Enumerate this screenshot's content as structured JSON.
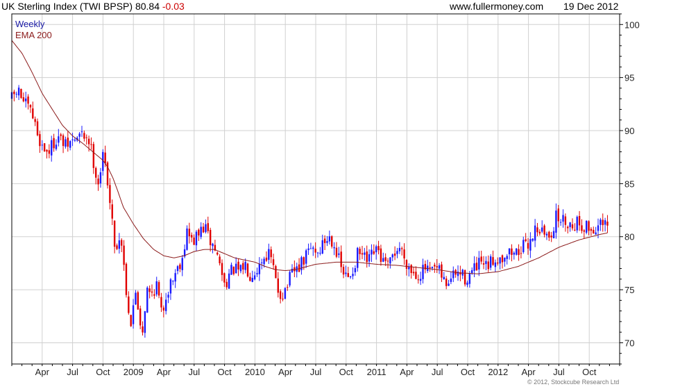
{
  "header": {
    "title": "UK Sterling Index (TWI BPSP)",
    "last": "80.84",
    "change": "-0.03",
    "site": "www.fullermoney.com",
    "date": "19 Dec 2012"
  },
  "legend": {
    "weekly": "Weekly",
    "ema": "EMA 200"
  },
  "copyright": "© 2012, Stockcube Research Ltd",
  "colors": {
    "up": "#1a1aff",
    "down": "#e00000",
    "ema": "#8b1a1a",
    "grid": "#d0d0d0",
    "frame": "#000000"
  },
  "chart_data": {
    "type": "candlestick",
    "title": "UK Sterling Index (TWI BPSP)",
    "ylim": [
      68,
      101
    ],
    "yticks": [
      70,
      75,
      80,
      85,
      90,
      95,
      100
    ],
    "x_axis_labels": [
      "Apr",
      "Jul",
      "Oct",
      "2009",
      "Apr",
      "Jul",
      "Oct",
      "2010",
      "Apr",
      "Jul",
      "Oct",
      "2011",
      "Apr",
      "Jul",
      "Oct",
      "2012",
      "Apr",
      "Jul",
      "Oct"
    ],
    "x_labels_month_index": [
      3,
      6,
      9,
      12,
      15,
      18,
      21,
      24,
      27,
      30,
      33,
      36,
      39,
      42,
      45,
      48,
      51,
      54,
      57
    ],
    "x_range_months": [
      0,
      60
    ],
    "weekly_close_anchors": [
      [
        0.0,
        93.0
      ],
      [
        0.6,
        93.8
      ],
      [
        1.3,
        92.5
      ],
      [
        2.0,
        91.5
      ],
      [
        2.6,
        89.5
      ],
      [
        3.0,
        88.5
      ],
      [
        3.6,
        88.0
      ],
      [
        4.5,
        89.5
      ],
      [
        5.3,
        88.5
      ],
      [
        6.0,
        89.0
      ],
      [
        6.7,
        89.5
      ],
      [
        7.5,
        89.5
      ],
      [
        8.0,
        87.5
      ],
      [
        8.5,
        85.0
      ],
      [
        9.0,
        87.5
      ],
      [
        9.4,
        86.0
      ],
      [
        9.8,
        82.0
      ],
      [
        10.3,
        78.5
      ],
      [
        10.7,
        80.5
      ],
      [
        11.0,
        78.0
      ],
      [
        11.4,
        74.0
      ],
      [
        11.8,
        71.5
      ],
      [
        12.2,
        75.0
      ],
      [
        12.6,
        72.5
      ],
      [
        12.9,
        71.0
      ],
      [
        13.3,
        75.0
      ],
      [
        13.7,
        74.5
      ],
      [
        14.3,
        75.5
      ],
      [
        14.8,
        72.5
      ],
      [
        15.2,
        74.5
      ],
      [
        15.6,
        75.5
      ],
      [
        16.3,
        77.0
      ],
      [
        16.8,
        78.0
      ],
      [
        17.3,
        80.5
      ],
      [
        17.8,
        79.5
      ],
      [
        18.3,
        80.0
      ],
      [
        19.0,
        81.0
      ],
      [
        19.6,
        79.5
      ],
      [
        20.0,
        79.0
      ],
      [
        20.5,
        77.5
      ],
      [
        21.0,
        75.5
      ],
      [
        21.5,
        76.5
      ],
      [
        22.0,
        77.0
      ],
      [
        22.5,
        76.5
      ],
      [
        23.0,
        77.5
      ],
      [
        23.5,
        76.5
      ],
      [
        24.2,
        77.0
      ],
      [
        24.8,
        78.0
      ],
      [
        25.3,
        78.5
      ],
      [
        25.7,
        77.5
      ],
      [
        26.2,
        75.0
      ],
      [
        26.7,
        74.5
      ],
      [
        27.2,
        75.5
      ],
      [
        27.7,
        76.5
      ],
      [
        28.2,
        77.0
      ],
      [
        28.7,
        77.5
      ],
      [
        29.2,
        78.5
      ],
      [
        29.7,
        79.0
      ],
      [
        30.2,
        78.5
      ],
      [
        30.8,
        79.5
      ],
      [
        31.4,
        80.0
      ],
      [
        31.8,
        79.5
      ],
      [
        32.2,
        78.0
      ],
      [
        32.7,
        76.5
      ],
      [
        33.2,
        76.0
      ],
      [
        33.7,
        77.0
      ],
      [
        34.2,
        78.5
      ],
      [
        34.7,
        78.0
      ],
      [
        35.2,
        77.5
      ],
      [
        35.7,
        78.5
      ],
      [
        36.2,
        78.5
      ],
      [
        36.7,
        77.5
      ],
      [
        37.2,
        77.0
      ],
      [
        37.7,
        78.5
      ],
      [
        38.3,
        79.0
      ],
      [
        38.8,
        78.0
      ],
      [
        39.3,
        77.0
      ],
      [
        39.8,
        76.5
      ],
      [
        40.3,
        76.5
      ],
      [
        40.8,
        77.0
      ],
      [
        41.3,
        76.5
      ],
      [
        41.8,
        77.0
      ],
      [
        42.3,
        76.5
      ],
      [
        42.8,
        75.5
      ],
      [
        43.3,
        76.0
      ],
      [
        43.8,
        76.5
      ],
      [
        44.3,
        76.5
      ],
      [
        44.8,
        76.0
      ],
      [
        45.3,
        76.5
      ],
      [
        45.8,
        77.0
      ],
      [
        46.3,
        77.5
      ],
      [
        46.8,
        77.0
      ],
      [
        47.3,
        77.5
      ],
      [
        47.8,
        78.0
      ],
      [
        48.3,
        78.0
      ],
      [
        48.8,
        78.5
      ],
      [
        49.3,
        78.5
      ],
      [
        49.8,
        78.5
      ],
      [
        50.3,
        79.0
      ],
      [
        50.8,
        79.0
      ],
      [
        51.3,
        80.0
      ],
      [
        51.8,
        81.0
      ],
      [
        52.3,
        80.5
      ],
      [
        52.8,
        80.0
      ],
      [
        53.3,
        80.5
      ],
      [
        53.8,
        82.0
      ],
      [
        54.3,
        81.5
      ],
      [
        54.8,
        81.5
      ],
      [
        55.3,
        81.0
      ],
      [
        55.8,
        81.5
      ],
      [
        56.3,
        81.0
      ],
      [
        56.8,
        81.0
      ],
      [
        57.3,
        80.5
      ],
      [
        57.8,
        81.0
      ],
      [
        58.3,
        81.0
      ],
      [
        58.8,
        80.8
      ]
    ],
    "ema_anchors": [
      [
        0.0,
        98.5
      ],
      [
        1.0,
        97.3
      ],
      [
        2.0,
        95.5
      ],
      [
        3.0,
        93.5
      ],
      [
        4.0,
        92.0
      ],
      [
        5.0,
        90.5
      ],
      [
        6.0,
        89.5
      ],
      [
        7.0,
        88.8
      ],
      [
        8.0,
        88.0
      ],
      [
        9.0,
        87.2
      ],
      [
        9.5,
        86.5
      ],
      [
        10.0,
        85.5
      ],
      [
        10.5,
        84.2
      ],
      [
        11.0,
        82.8
      ],
      [
        12.0,
        81.2
      ],
      [
        13.0,
        79.8
      ],
      [
        14.0,
        78.8
      ],
      [
        15.0,
        78.2
      ],
      [
        16.0,
        78.0
      ],
      [
        17.0,
        78.2
      ],
      [
        18.0,
        78.6
      ],
      [
        19.0,
        78.8
      ],
      [
        20.0,
        78.8
      ],
      [
        21.0,
        78.4
      ],
      [
        22.0,
        78.0
      ],
      [
        24.0,
        77.6
      ],
      [
        25.0,
        77.2
      ],
      [
        26.0,
        76.9
      ],
      [
        27.0,
        76.8
      ],
      [
        28.0,
        76.9
      ],
      [
        30.0,
        77.4
      ],
      [
        32.0,
        77.6
      ],
      [
        34.0,
        77.6
      ],
      [
        36.0,
        77.4
      ],
      [
        38.0,
        77.3
      ],
      [
        40.0,
        77.1
      ],
      [
        42.0,
        76.9
      ],
      [
        44.0,
        76.6
      ],
      [
        46.0,
        76.5
      ],
      [
        48.0,
        76.7
      ],
      [
        50.0,
        77.2
      ],
      [
        52.0,
        78.0
      ],
      [
        54.0,
        79.0
      ],
      [
        56.0,
        79.7
      ],
      [
        58.0,
        80.2
      ],
      [
        59.0,
        80.4
      ]
    ]
  }
}
